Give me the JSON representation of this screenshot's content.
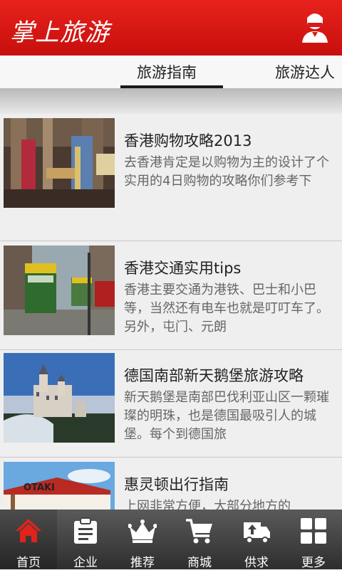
{
  "header": {
    "title": "掌上旅游",
    "profile_icon": "user-icon"
  },
  "tabs": [
    {
      "label": "旅游指南",
      "selected": true
    },
    {
      "label": "旅游达人",
      "selected": false
    }
  ],
  "articles": [
    {
      "title": "香港购物攻略2013",
      "desc": "去香港肯定是以购物为主的设计了个实用的4日购物的攻略你们参考下"
    },
    {
      "title": "香港交通实用tips",
      "desc": "香港主要交通为港铁、巴士和小巴等，当然还有电车也就是叮叮车了。另外，屯门、元朗"
    },
    {
      "title": "德国南部新天鹅堡旅游攻略",
      "desc": "新天鹅堡是南部巴伐利亚山区一颗璀璨的明珠，也是德国最吸引人的城堡。每个到德国旅"
    },
    {
      "title": "惠灵顿出行指南",
      "desc": "上网非常方便，大部分地方的",
      "thumb_sign": "OTAKI"
    }
  ],
  "nav": [
    {
      "label": "首页",
      "icon": "home-icon",
      "active": true
    },
    {
      "label": "企业",
      "icon": "clipboard-icon",
      "active": false
    },
    {
      "label": "推荐",
      "icon": "crown-icon",
      "active": false
    },
    {
      "label": "商城",
      "icon": "cart-icon",
      "active": false
    },
    {
      "label": "供求",
      "icon": "truck-icon",
      "active": false
    },
    {
      "label": "更多",
      "icon": "grid-icon",
      "active": false
    }
  ],
  "colors": {
    "header_red": "#d9191a",
    "home_active": "#e0241b"
  }
}
